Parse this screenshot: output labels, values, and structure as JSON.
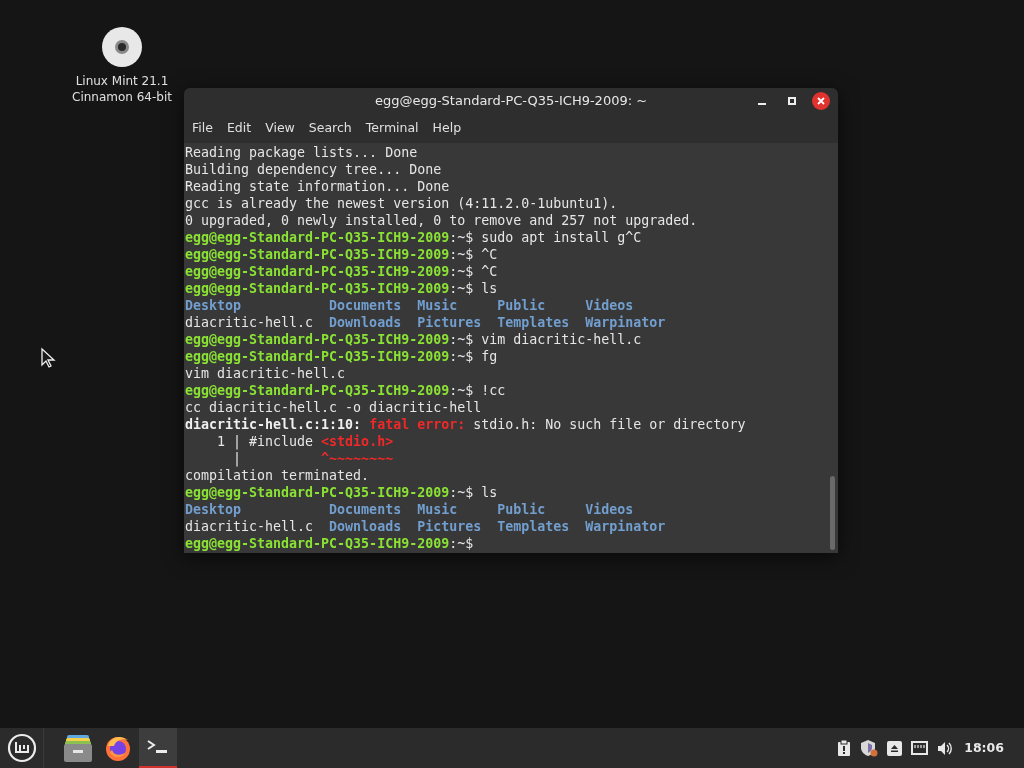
{
  "desktop": {
    "icons": [
      {
        "label": "Linux Mint 21.1\nCinnamon 64-bit"
      }
    ]
  },
  "window": {
    "title": "egg@egg-Standard-PC-Q35-ICH9-2009: ~",
    "menu": [
      "File",
      "Edit",
      "View",
      "Search",
      "Terminal",
      "Help"
    ],
    "lines": [
      {
        "kind": "text",
        "segments": [
          {
            "text": "Reading package lists... Done",
            "kind": "plain"
          }
        ]
      },
      {
        "kind": "text",
        "segments": [
          {
            "text": "Building dependency tree... Done",
            "kind": "plain"
          }
        ]
      },
      {
        "kind": "text",
        "segments": [
          {
            "text": "Reading state information... Done",
            "kind": "plain"
          }
        ]
      },
      {
        "kind": "text",
        "segments": [
          {
            "text": "gcc is already the newest version (4:11.2.0-1ubuntu1).",
            "kind": "plain"
          }
        ]
      },
      {
        "kind": "text",
        "segments": [
          {
            "text": "0 upgraded, 0 newly installed, 0 to remove and 257 not upgraded.",
            "kind": "plain"
          }
        ]
      },
      {
        "kind": "text",
        "segments": [
          {
            "text": "egg@egg-Standard-PC-Q35-ICH9-2009",
            "kind": "prompt"
          },
          {
            "text": ":~$ sudo apt install g^C",
            "kind": "plain"
          }
        ]
      },
      {
        "kind": "text",
        "segments": [
          {
            "text": "egg@egg-Standard-PC-Q35-ICH9-2009",
            "kind": "prompt"
          },
          {
            "text": ":~$ ^C",
            "kind": "plain"
          }
        ]
      },
      {
        "kind": "text",
        "segments": [
          {
            "text": "egg@egg-Standard-PC-Q35-ICH9-2009",
            "kind": "prompt"
          },
          {
            "text": ":~$ ^C",
            "kind": "plain"
          }
        ]
      },
      {
        "kind": "text",
        "segments": [
          {
            "text": "egg@egg-Standard-PC-Q35-ICH9-2009",
            "kind": "prompt"
          },
          {
            "text": ":~$ ls",
            "kind": "plain"
          }
        ]
      },
      {
        "kind": "listing",
        "entries": [
          {
            "text": "Desktop",
            "dir": true
          },
          {
            "text": "Documents",
            "dir": true
          },
          {
            "text": "Music",
            "dir": true
          },
          {
            "text": "Public",
            "dir": true
          },
          {
            "text": "Videos",
            "dir": true
          }
        ]
      },
      {
        "kind": "listing",
        "entries": [
          {
            "text": "diacritic-hell.c",
            "dir": false
          },
          {
            "text": "Downloads",
            "dir": true
          },
          {
            "text": "Pictures",
            "dir": true
          },
          {
            "text": "Templates",
            "dir": true
          },
          {
            "text": "Warpinator",
            "dir": true
          }
        ]
      },
      {
        "kind": "text",
        "segments": [
          {
            "text": "egg@egg-Standard-PC-Q35-ICH9-2009",
            "kind": "prompt"
          },
          {
            "text": ":~$ vim diacritic-hell.c",
            "kind": "plain"
          }
        ]
      },
      {
        "kind": "text",
        "segments": [
          {
            "text": "egg@egg-Standard-PC-Q35-ICH9-2009",
            "kind": "prompt"
          },
          {
            "text": ":~$ fg",
            "kind": "plain"
          }
        ]
      },
      {
        "kind": "text",
        "segments": [
          {
            "text": "vim diacritic-hell.c",
            "kind": "plain"
          }
        ]
      },
      {
        "kind": "text",
        "segments": [
          {
            "text": "egg@egg-Standard-PC-Q35-ICH9-2009",
            "kind": "prompt"
          },
          {
            "text": ":~$ !cc",
            "kind": "plain"
          }
        ]
      },
      {
        "kind": "text",
        "segments": [
          {
            "text": "cc diacritic-hell.c -o diacritic-hell",
            "kind": "plain"
          }
        ]
      },
      {
        "kind": "text",
        "segments": [
          {
            "text": "diacritic-hell.c:1:10: ",
            "kind": "bold"
          },
          {
            "text": "fatal error: ",
            "kind": "error"
          },
          {
            "text": "stdio.h: No such file or directory",
            "kind": "plain"
          }
        ]
      },
      {
        "kind": "text",
        "segments": [
          {
            "text": "    1 | #include ",
            "kind": "plain"
          },
          {
            "text": "<stdio.h>",
            "kind": "error"
          }
        ]
      },
      {
        "kind": "text",
        "segments": [
          {
            "text": "      |          ",
            "kind": "plain"
          },
          {
            "text": "^~~~~~~~~",
            "kind": "error"
          }
        ]
      },
      {
        "kind": "text",
        "segments": [
          {
            "text": "compilation terminated.",
            "kind": "plain"
          }
        ]
      },
      {
        "kind": "text",
        "segments": [
          {
            "text": "egg@egg-Standard-PC-Q35-ICH9-2009",
            "kind": "prompt"
          },
          {
            "text": ":~$ ls",
            "kind": "plain"
          }
        ]
      },
      {
        "kind": "listing",
        "entries": [
          {
            "text": "Desktop",
            "dir": true
          },
          {
            "text": "Documents",
            "dir": true
          },
          {
            "text": "Music",
            "dir": true
          },
          {
            "text": "Public",
            "dir": true
          },
          {
            "text": "Videos",
            "dir": true
          }
        ]
      },
      {
        "kind": "listing",
        "entries": [
          {
            "text": "diacritic-hell.c",
            "dir": false
          },
          {
            "text": "Downloads",
            "dir": true
          },
          {
            "text": "Pictures",
            "dir": true
          },
          {
            "text": "Templates",
            "dir": true
          },
          {
            "text": "Warpinator",
            "dir": true
          }
        ]
      },
      {
        "kind": "text",
        "segments": [
          {
            "text": "egg@egg-Standard-PC-Q35-ICH9-2009",
            "kind": "prompt"
          },
          {
            "text": ":~$",
            "kind": "plain"
          }
        ]
      }
    ]
  },
  "taskbar": {
    "apps": [
      {
        "kind": "files",
        "active": false
      },
      {
        "kind": "browser",
        "active": false
      },
      {
        "kind": "terminal",
        "active": true
      }
    ],
    "clock": "18:06"
  }
}
